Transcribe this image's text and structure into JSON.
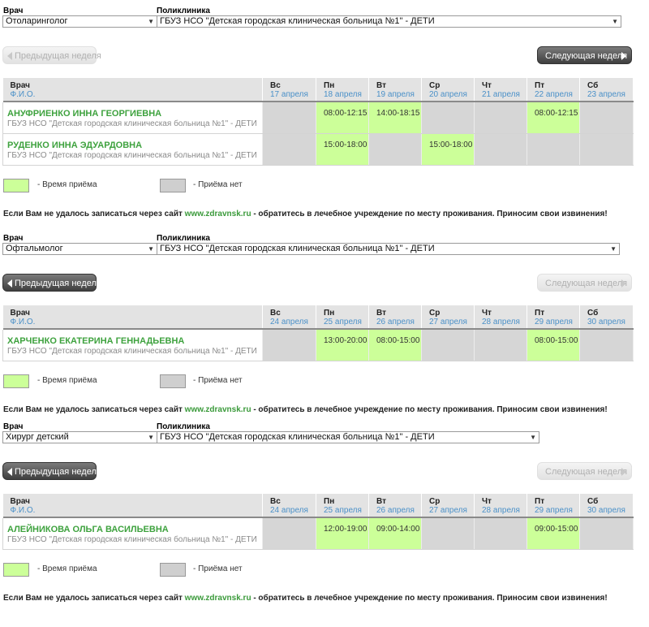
{
  "labels": {
    "doctor": "Врач",
    "clinic": "Поликлиника",
    "prev_week": "Предыдущая неделя",
    "next_week": "Следующая неделя",
    "col_doctor": "Врач",
    "col_fio": "Ф.И.О.",
    "legend_on": "- Время приёма",
    "legend_off": "- Приёма нет",
    "notice_pre": "Если Вам не удалось записаться через сайт ",
    "notice_site": "www.zdravnsk.ru",
    "notice_post": " - обратитесь в лечебное учреждение по месту проживания. Приносим свои извинения!"
  },
  "colors": {
    "reception": "#ccff99",
    "no_reception": "#d6d6d6",
    "doctor_name": "#3ea23e",
    "date_link": "#4a90c8"
  },
  "sections": [
    {
      "specialty": "Отоларинголог",
      "clinic": "ГБУЗ НСО \"Детская городская клиническая больница №1\" - ДЕТИ",
      "prev_enabled": false,
      "next_enabled": true,
      "days": [
        {
          "dow": "Вс",
          "date": "17 апреля"
        },
        {
          "dow": "Пн",
          "date": "18 апреля"
        },
        {
          "dow": "Вт",
          "date": "19 апреля"
        },
        {
          "dow": "Ср",
          "date": "20 апреля"
        },
        {
          "dow": "Чт",
          "date": "21 апреля"
        },
        {
          "dow": "Пт",
          "date": "22 апреля"
        },
        {
          "dow": "Сб",
          "date": "23 апреля"
        }
      ],
      "doctors": [
        {
          "name": "АНУФРИЕНКО ИННА ГЕОРГИЕВНА",
          "org": "ГБУЗ НСО \"Детская городская клиническая больница №1\" - ДЕТИ",
          "slots": [
            "",
            "08:00-12:15",
            "14:00-18:15",
            "",
            "",
            "08:00-12:15",
            ""
          ]
        },
        {
          "name": "РУДЕНКО ИННА ЭДУАРДОВНА",
          "org": "ГБУЗ НСО \"Детская городская клиническая больница №1\" - ДЕТИ",
          "slots": [
            "",
            "15:00-18:00",
            "",
            "15:00-18:00",
            "",
            "",
            ""
          ]
        }
      ]
    },
    {
      "specialty": "Офтальмолог",
      "clinic": "ГБУЗ НСО \"Детская городская клиническая больница №1\" - ДЕТИ",
      "prev_enabled": true,
      "next_enabled": false,
      "days": [
        {
          "dow": "Вс",
          "date": "24 апреля"
        },
        {
          "dow": "Пн",
          "date": "25 апреля"
        },
        {
          "dow": "Вт",
          "date": "26 апреля"
        },
        {
          "dow": "Ср",
          "date": "27 апреля"
        },
        {
          "dow": "Чт",
          "date": "28 апреля"
        },
        {
          "dow": "Пт",
          "date": "29 апреля"
        },
        {
          "dow": "Сб",
          "date": "30 апреля"
        }
      ],
      "doctors": [
        {
          "name": "ХАРЧЕНКО ЕКАТЕРИНА ГЕННАДЬЕВНА",
          "org": "ГБУЗ НСО \"Детская городская клиническая больница №1\" - ДЕТИ",
          "slots": [
            "",
            "13:00-20:00",
            "08:00-15:00",
            "",
            "",
            "08:00-15:00",
            ""
          ]
        }
      ]
    },
    {
      "specialty": "Хирург детский",
      "clinic": "ГБУЗ НСО \"Детская городская клиническая больница №1\" - ДЕТИ",
      "prev_enabled": true,
      "next_enabled": false,
      "days": [
        {
          "dow": "Вс",
          "date": "24 апреля"
        },
        {
          "dow": "Пн",
          "date": "25 апреля"
        },
        {
          "dow": "Вт",
          "date": "26 апреля"
        },
        {
          "dow": "Ср",
          "date": "27 апреля"
        },
        {
          "dow": "Чт",
          "date": "28 апреля"
        },
        {
          "dow": "Пт",
          "date": "29 апреля"
        },
        {
          "dow": "Сб",
          "date": "30 апреля"
        }
      ],
      "doctors": [
        {
          "name": "АЛЕЙНИКОВА ОЛЬГА ВАСИЛЬЕВНА",
          "org": "ГБУЗ НСО \"Детская городская клиническая больница №1\" - ДЕТИ",
          "slots": [
            "",
            "12:00-19:00",
            "09:00-14:00",
            "",
            "",
            "09:00-15:00",
            ""
          ]
        }
      ]
    }
  ]
}
